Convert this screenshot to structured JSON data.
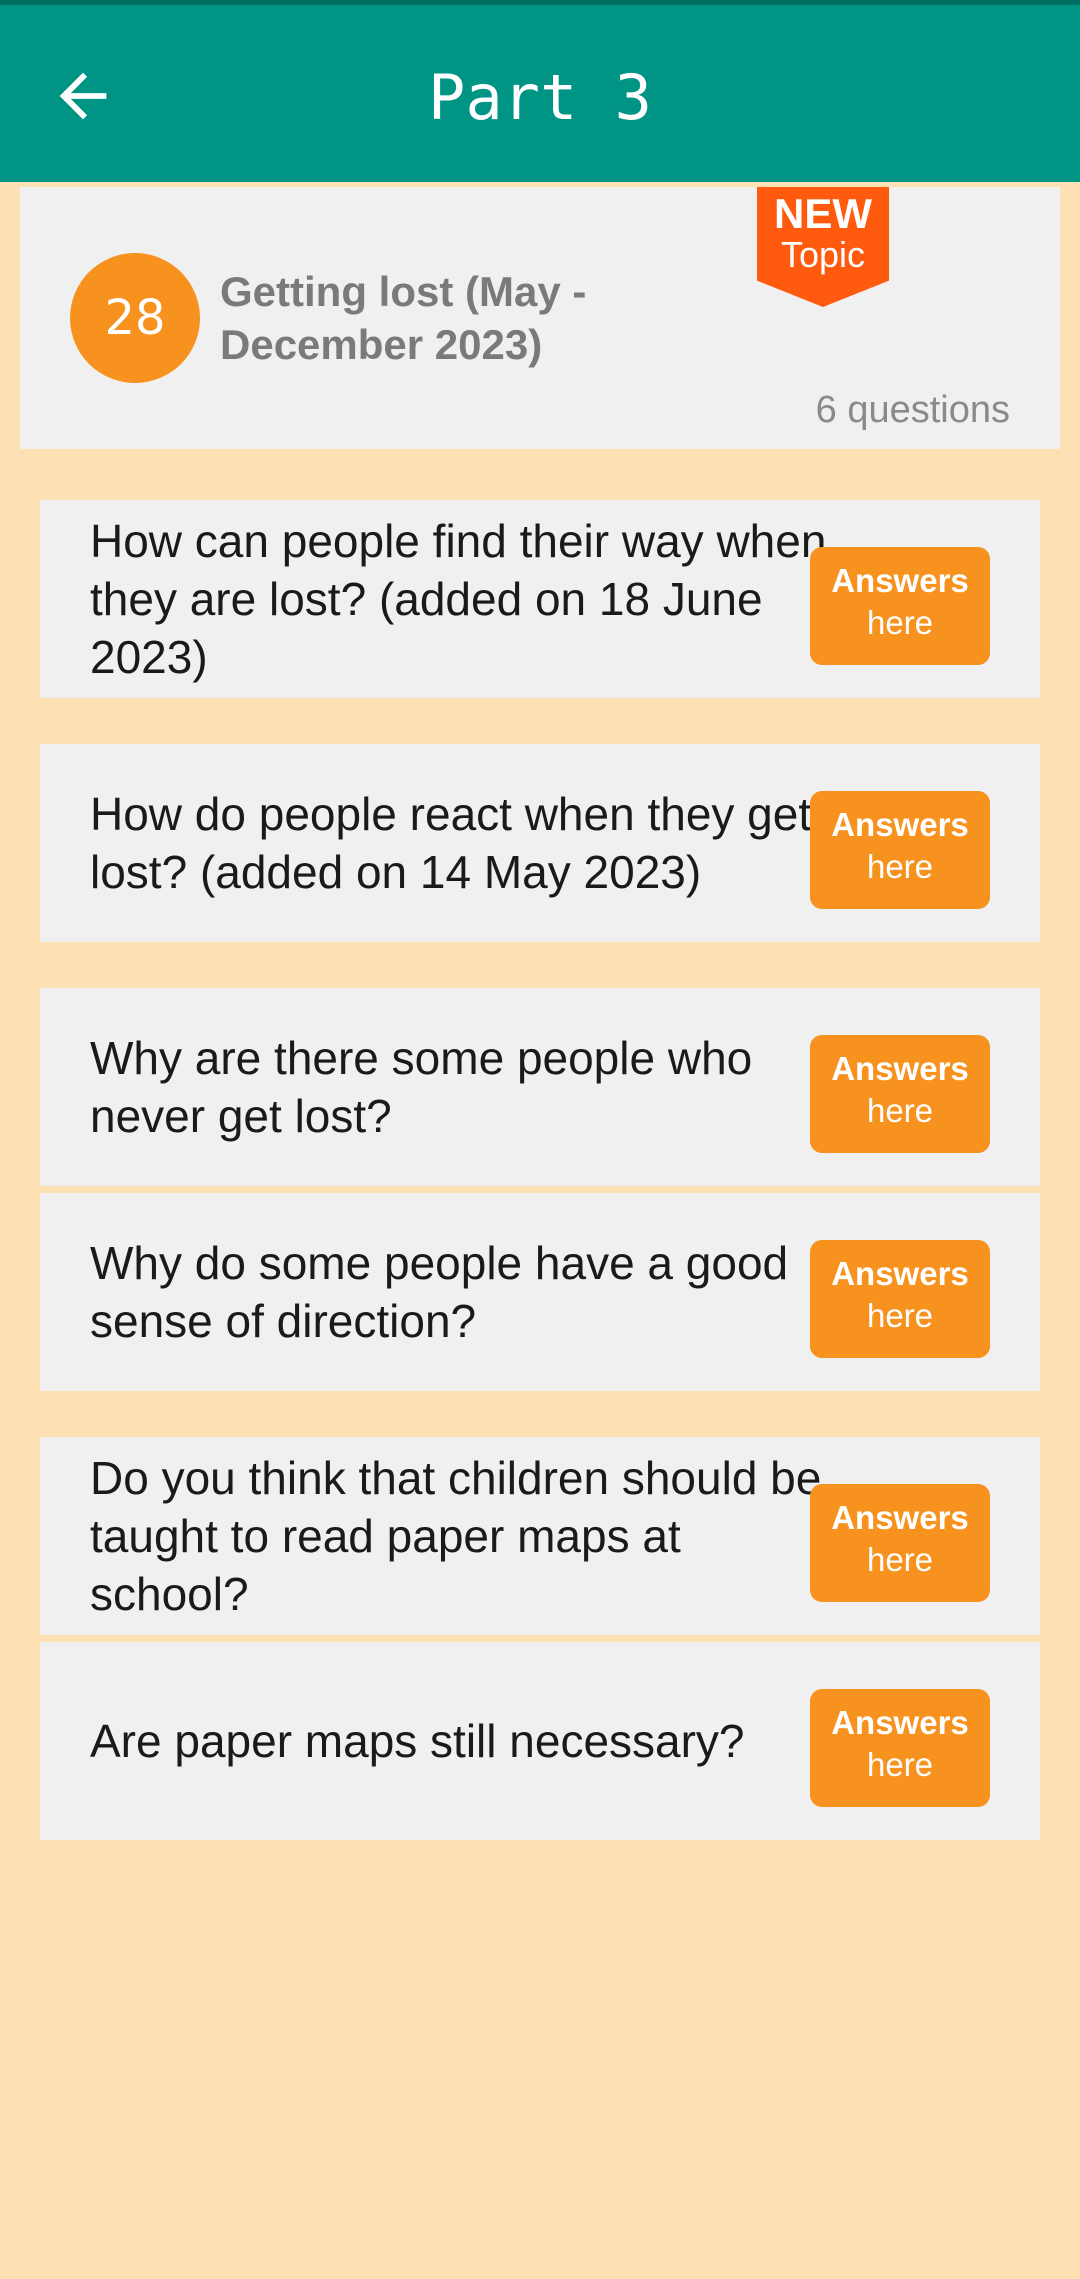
{
  "header": {
    "title": "Part 3",
    "back_icon": "arrow-left-icon"
  },
  "topic": {
    "number": "28",
    "title": "Getting lost (May - December 2023)",
    "badge_new": "NEW",
    "badge_topic": "Topic",
    "question_count": "6 questions"
  },
  "questions": [
    {
      "text": "How can people find their way when they are lost? (added on 18 June 2023)",
      "btn_line1": "Answers",
      "btn_line2": "here"
    },
    {
      "text": "How do people react when they get lost? (added on 14 May 2023)",
      "btn_line1": "Answers",
      "btn_line2": "here"
    },
    {
      "text": "Why are there some people who never get lost?",
      "btn_line1": "Answers",
      "btn_line2": "here"
    },
    {
      "text": "Why do some people have a good sense of direction?",
      "btn_line1": "Answers",
      "btn_line2": "here"
    },
    {
      "text": "Do you think that children should be taught to read paper maps at school?",
      "btn_line1": "Answers",
      "btn_line2": "here"
    },
    {
      "text": "Are paper maps still necessary?",
      "btn_line1": "Answers",
      "btn_line2": "here"
    }
  ],
  "colors": {
    "appbar": "#009485",
    "background": "#fde0b4",
    "accent": "#f7921e",
    "badge": "#ff5a0e"
  }
}
